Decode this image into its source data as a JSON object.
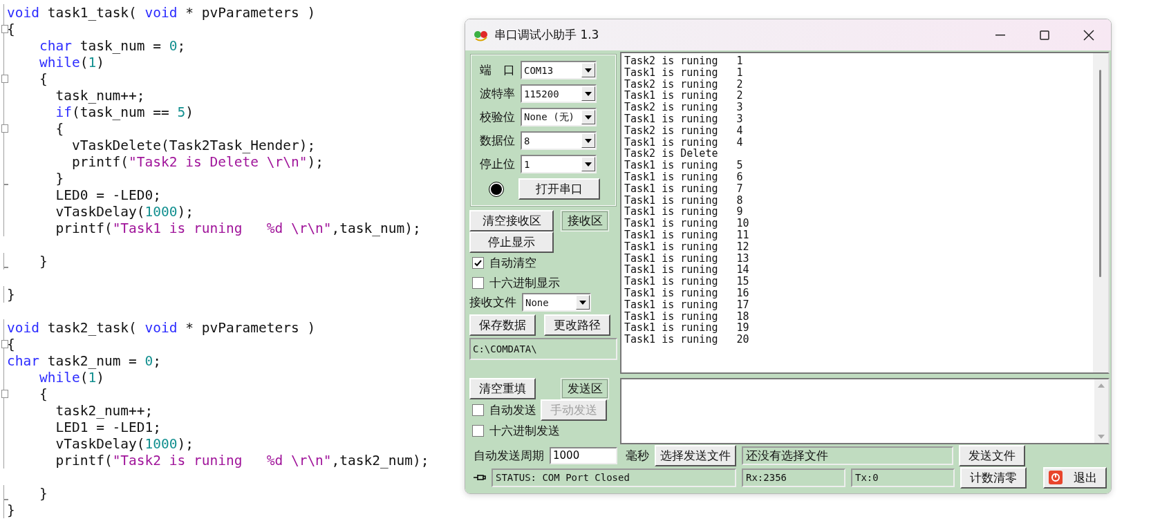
{
  "code": {
    "blocks": [
      {
        "lines": [
          {
            "tokens": [
              {
                "kind": "kw",
                "text": "void"
              },
              {
                "kind": "plain",
                "text": " task1_task( "
              },
              {
                "kind": "kw",
                "text": "void"
              },
              {
                "kind": "plain",
                "text": " * pvParameters )"
              }
            ]
          },
          {
            "fold_start": true,
            "tokens": [
              {
                "kind": "plain",
                "text": "{"
              }
            ]
          },
          {
            "tokens": [
              {
                "kind": "kw",
                "text": "    char"
              },
              {
                "kind": "plain",
                "text": " task_num = "
              },
              {
                "kind": "num",
                "text": "0"
              },
              {
                "kind": "plain",
                "text": ";"
              }
            ]
          },
          {
            "tokens": [
              {
                "kind": "kw",
                "text": "    while"
              },
              {
                "kind": "plain",
                "text": "("
              },
              {
                "kind": "num",
                "text": "1"
              },
              {
                "kind": "plain",
                "text": ")"
              }
            ]
          },
          {
            "fold_start": true,
            "tokens": [
              {
                "kind": "plain",
                "text": "    {"
              }
            ]
          },
          {
            "tokens": [
              {
                "kind": "plain",
                "text": "      task_num++;"
              }
            ]
          },
          {
            "tokens": [
              {
                "kind": "kw",
                "text": "      if"
              },
              {
                "kind": "plain",
                "text": "(task_num == "
              },
              {
                "kind": "num",
                "text": "5"
              },
              {
                "kind": "plain",
                "text": ")"
              }
            ]
          },
          {
            "fold_start": true,
            "tokens": [
              {
                "kind": "plain",
                "text": "      {"
              }
            ]
          },
          {
            "tokens": [
              {
                "kind": "plain",
                "text": "        vTaskDelete(Task2Task_Hender);"
              }
            ]
          },
          {
            "tokens": [
              {
                "kind": "plain",
                "text": "        printf("
              },
              {
                "kind": "str",
                "text": "\"Task2 is Delete \\r\\n\""
              },
              {
                "kind": "plain",
                "text": ");"
              }
            ]
          },
          {
            "fold_end": true,
            "tokens": [
              {
                "kind": "plain",
                "text": "      }"
              }
            ]
          },
          {
            "tokens": [
              {
                "kind": "plain",
                "text": "      LED0 = -LED0;"
              }
            ]
          },
          {
            "tokens": [
              {
                "kind": "plain",
                "text": "      vTaskDelay("
              },
              {
                "kind": "num",
                "text": "1000"
              },
              {
                "kind": "plain",
                "text": ");"
              }
            ]
          },
          {
            "tokens": [
              {
                "kind": "plain",
                "text": "      printf("
              },
              {
                "kind": "str",
                "text": "\"Task1 is runing   %d \\r\\n\""
              },
              {
                "kind": "plain",
                "text": ",task_num);"
              }
            ]
          }
        ]
      },
      {
        "lines": [
          {
            "fold_end": true,
            "tokens": [
              {
                "kind": "plain",
                "text": "    }"
              }
            ]
          }
        ]
      },
      {
        "lines": [
          {
            "tokens": [
              {
                "kind": "plain",
                "text": "}"
              }
            ]
          }
        ]
      },
      {
        "lines": [
          {
            "tokens": [
              {
                "kind": "kw",
                "text": "void"
              },
              {
                "kind": "plain",
                "text": " task2_task( "
              },
              {
                "kind": "kw",
                "text": "void"
              },
              {
                "kind": "plain",
                "text": " * pvParameters )"
              }
            ]
          },
          {
            "fold_start": true,
            "tokens": [
              {
                "kind": "plain",
                "text": "{"
              }
            ]
          },
          {
            "tokens": [
              {
                "kind": "kw",
                "text": "char"
              },
              {
                "kind": "plain",
                "text": " task2_num = "
              },
              {
                "kind": "num",
                "text": "0"
              },
              {
                "kind": "plain",
                "text": ";"
              }
            ]
          },
          {
            "tokens": [
              {
                "kind": "kw",
                "text": "    while"
              },
              {
                "kind": "plain",
                "text": "("
              },
              {
                "kind": "num",
                "text": "1"
              },
              {
                "kind": "plain",
                "text": ")"
              }
            ]
          },
          {
            "fold_start": true,
            "tokens": [
              {
                "kind": "plain",
                "text": "    {"
              }
            ]
          },
          {
            "tokens": [
              {
                "kind": "plain",
                "text": "      task2_num++;"
              }
            ]
          },
          {
            "tokens": [
              {
                "kind": "plain",
                "text": "      LED1 = -LED1;"
              }
            ]
          },
          {
            "tokens": [
              {
                "kind": "plain",
                "text": "      vTaskDelay("
              },
              {
                "kind": "num",
                "text": "1000"
              },
              {
                "kind": "plain",
                "text": ");"
              }
            ]
          },
          {
            "tokens": [
              {
                "kind": "plain",
                "text": "      printf("
              },
              {
                "kind": "str",
                "text": "\"Task2 is runing   %d \\r\\n\""
              },
              {
                "kind": "plain",
                "text": ",task2_num);"
              }
            ]
          }
        ]
      },
      {
        "lines": [
          {
            "fold_end": true,
            "tokens": [
              {
                "kind": "plain",
                "text": "    }"
              }
            ]
          },
          {
            "tokens": [
              {
                "kind": "plain",
                "text": "}"
              }
            ]
          }
        ]
      }
    ]
  },
  "window": {
    "title": "串口调试小助手 1.3"
  },
  "settings": [
    {
      "label": "端　口",
      "value": "COM13"
    },
    {
      "label": "波特率",
      "value": "115200"
    },
    {
      "label": "校验位",
      "value": "None (无)"
    },
    {
      "label": "数据位",
      "value": "8"
    },
    {
      "label": "停止位",
      "value": "1"
    }
  ],
  "port": {
    "open": false,
    "button": "打开串口"
  },
  "receive": {
    "clear_button": "清空接收区",
    "area_button": "接收区",
    "stop_button": "停止显示",
    "options": [
      {
        "label": "自动清空",
        "checked": true
      },
      {
        "label": "十六进制显示",
        "checked": false
      }
    ],
    "file_label": "接收文件",
    "file_value": "None",
    "save_button": "保存数据",
    "path_button": "更改路径",
    "path": "C:\\COMDATA\\"
  },
  "output": {
    "lines": [
      "Task2 is runing   1",
      "Task1 is runing   1",
      "Task2 is runing   2",
      "Task1 is runing   2",
      "Task2 is runing   3",
      "Task1 is runing   3",
      "Task2 is runing   4",
      "Task1 is runing   4",
      "Task2 is Delete",
      "Task1 is runing   5",
      "Task1 is runing   6",
      "Task1 is runing   7",
      "Task1 is runing   8",
      "Task1 is runing   9",
      "Task1 is runing   10",
      "Task1 is runing   11",
      "Task1 is runing   12",
      "Task1 is runing   13",
      "Task1 is runing   14",
      "Task1 is runing   15",
      "Task1 is runing   16",
      "Task1 is runing   17",
      "Task1 is runing   18",
      "Task1 is runing   19",
      "Task1 is runing   20"
    ]
  },
  "send": {
    "clear_button": "清空重填",
    "area_button": "发送区",
    "auto_send": {
      "label": "自动发送",
      "checked": false
    },
    "manual_button": {
      "label": "手动发送",
      "disabled": true
    },
    "hex_send": {
      "label": "十六进制发送",
      "checked": false
    },
    "period_label": "自动发送周期",
    "period_value": "1000",
    "unit": "毫秒",
    "choose_file_button": "选择发送文件",
    "file_status": "还没有选择文件",
    "send_file_button": "发送文件"
  },
  "status_bar": {
    "status": "STATUS: COM Port Closed",
    "rx": "Rx:2356",
    "tx": "Tx:0",
    "reset_button": "计数清零",
    "exit_button": "退出"
  }
}
